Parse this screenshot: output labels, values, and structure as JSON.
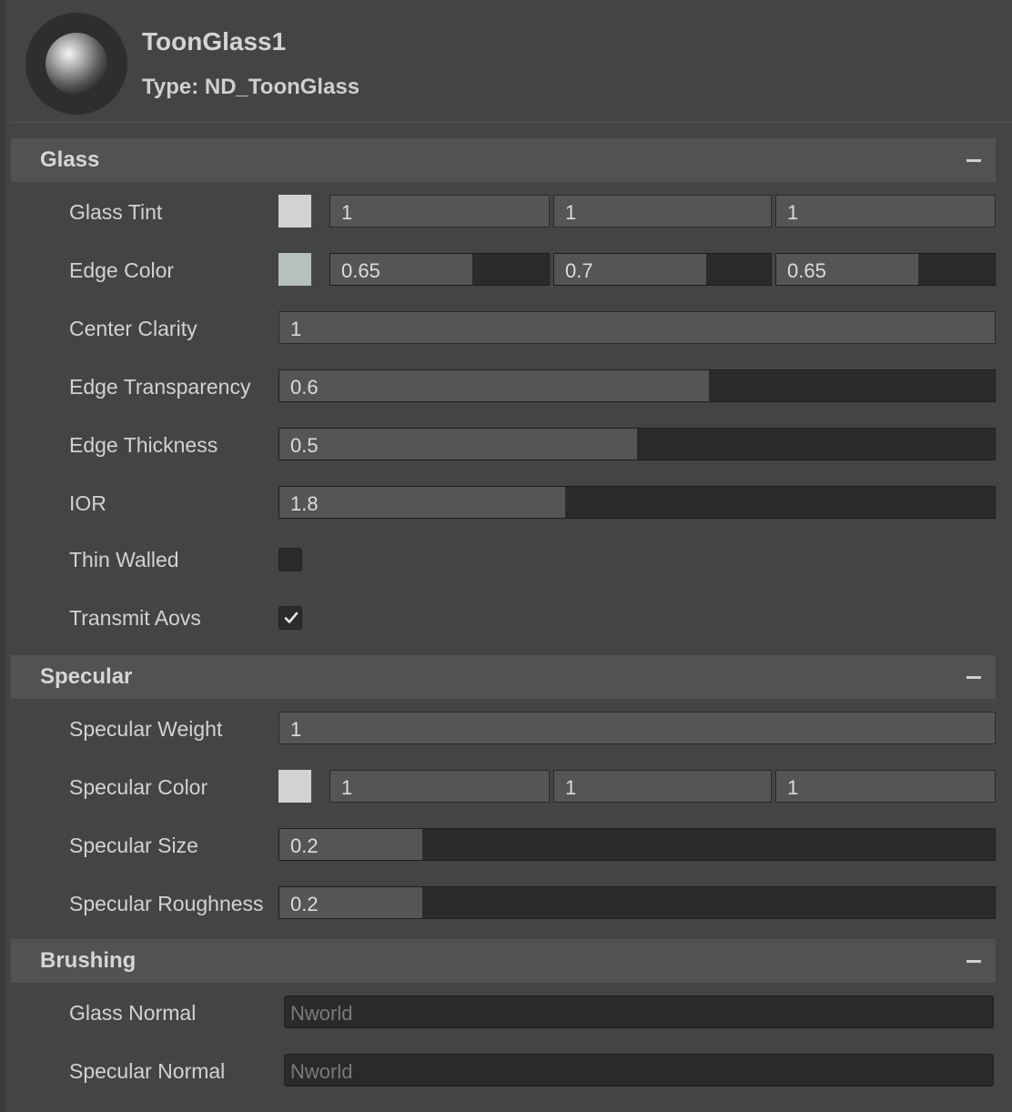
{
  "header": {
    "name": "ToonGlass1",
    "type": "Type: ND_ToonGlass"
  },
  "sections": {
    "glass": {
      "title": "Glass",
      "glass_tint": {
        "label": "Glass Tint",
        "swatch": "#d2d2d2",
        "r": "1",
        "g": "1",
        "b": "1"
      },
      "edge_color": {
        "label": "Edge Color",
        "swatch": "#b6c0bc",
        "r": "0.65",
        "g": "0.7",
        "b": "0.65",
        "r_fill": 0.65,
        "g_fill": 0.7,
        "b_fill": 0.65
      },
      "center_clarity": {
        "label": "Center Clarity",
        "value": "1"
      },
      "edge_transparency": {
        "label": "Edge Transparency",
        "value": "0.6",
        "fill": 0.6
      },
      "edge_thickness": {
        "label": "Edge Thickness",
        "value": "0.5",
        "fill": 0.5
      },
      "ior": {
        "label": "IOR",
        "value": "1.8",
        "fill": 0.4
      },
      "thin_walled": {
        "label": "Thin Walled",
        "checked": false
      },
      "transmit_aovs": {
        "label": "Transmit Aovs",
        "checked": true
      }
    },
    "specular": {
      "title": "Specular",
      "specular_weight": {
        "label": "Specular Weight",
        "value": "1"
      },
      "specular_color": {
        "label": "Specular Color",
        "swatch": "#d2d2d2",
        "r": "1",
        "g": "1",
        "b": "1"
      },
      "specular_size": {
        "label": "Specular Size",
        "value": "0.2",
        "fill": 0.2
      },
      "specular_roughness": {
        "label": "Specular Roughness",
        "value": "0.2",
        "fill": 0.2
      }
    },
    "brushing": {
      "title": "Brushing",
      "glass_normal": {
        "label": "Glass Normal",
        "placeholder": "Nworld"
      },
      "specular_normal": {
        "label": "Specular Normal",
        "placeholder": "Nworld"
      }
    }
  },
  "colors": {
    "background": "#444444",
    "section_header": "#525252",
    "slider_fill": "#555555",
    "slider_track": "#2b2b2b"
  }
}
